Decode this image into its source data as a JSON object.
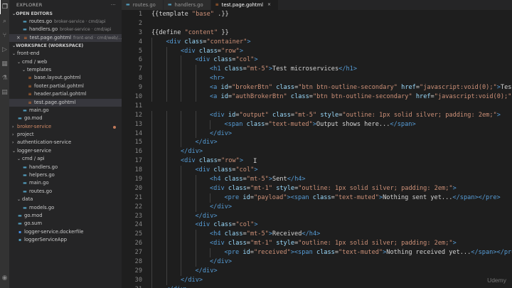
{
  "sidebar": {
    "title": "EXPLORER",
    "more": "···",
    "open_editors_label": "OPEN EDITORS",
    "open_editors": [
      {
        "name": "routes.go",
        "desc": "broker-service · cmd/api"
      },
      {
        "name": "handlers.go",
        "desc": "broker-service · cmd/api"
      },
      {
        "name": "test.page.gohtml",
        "desc": "front-end · cmd/web/...",
        "close": "×"
      }
    ],
    "workspace_label": "WORKSPACE (WORKSPACE)",
    "tree": [
      {
        "name": "front-end",
        "kind": "folder"
      },
      {
        "name": "cmd / web",
        "kind": "folder"
      },
      {
        "name": "templates",
        "kind": "folder"
      },
      {
        "name": "base.layout.gohtml",
        "kind": "file"
      },
      {
        "name": "footer.partial.gohtml",
        "kind": "file"
      },
      {
        "name": "header.partial.gohtml",
        "kind": "file"
      },
      {
        "name": "test.page.gohtml",
        "kind": "file"
      },
      {
        "name": "main.go",
        "kind": "file"
      },
      {
        "name": "go.mod",
        "kind": "file"
      },
      {
        "name": "broker-service",
        "kind": "folder"
      },
      {
        "name": "project",
        "kind": "folder"
      },
      {
        "name": "authentication-service",
        "kind": "folder"
      },
      {
        "name": "logger-service",
        "kind": "folder"
      },
      {
        "name": "cmd / api",
        "kind": "folder"
      },
      {
        "name": "handlers.go",
        "kind": "file"
      },
      {
        "name": "helpers.go",
        "kind": "file"
      },
      {
        "name": "main.go",
        "kind": "file"
      },
      {
        "name": "routes.go",
        "kind": "file"
      },
      {
        "name": "data",
        "kind": "folder"
      },
      {
        "name": "models.go",
        "kind": "file"
      },
      {
        "name": "go.mod",
        "kind": "file"
      },
      {
        "name": "go.sum",
        "kind": "file"
      },
      {
        "name": "logger-service.dockerfile",
        "kind": "file"
      },
      {
        "name": "loggerServiceApp",
        "kind": "file"
      }
    ]
  },
  "tabs": [
    {
      "label": "routes.go",
      "active": false
    },
    {
      "label": "handlers.go",
      "active": false
    },
    {
      "label": "test.page.gohtml",
      "active": true,
      "close": "×"
    }
  ],
  "code_lines": [
    "{{template \"base\" .}}",
    "",
    "{{define \"content\" }}",
    "    <div class=\"container\">",
    "        <div class=\"row\">",
    "            <div class=\"col\">",
    "                <h1 class=\"mt-5\">Test microservices</h1>",
    "                <hr>",
    "                <a id=\"brokerBtn\" class=\"btn btn-outline-secondary\" href=\"javascript:void(0);\">Tes",
    "                <a id=\"authBrokerBtn\" class=\"btn btn-outline-secondary\" href=\"javascript:void(0);\"",
    "",
    "                <div id=\"output\" class=\"mt-5\" style=\"outline: 1px solid silver; padding: 2em;\">",
    "                    <span class=\"text-muted\">Output shows here...</span>",
    "                </div>",
    "            </div>",
    "        </div>",
    "        <div class=\"row\">",
    "            <div class=\"col\">",
    "                <h4 class=\"mt-5\">Sent</h4>",
    "                <div class=\"mt-1\" style=\"outline: 1px solid silver; padding: 2em;\">",
    "                    <pre id=\"payload\"><span class=\"text-muted\">Nothing sent yet...</span></pre>",
    "                </div>",
    "            </div>",
    "            <div class=\"col\">",
    "                <h4 class=\"mt-5\">Received</h4>",
    "                <div class=\"mt-1\" style=\"outline: 1px solid silver; padding: 2em;\">",
    "                    <pre id=\"received\"><span class=\"text-muted\">Nothing received yet...</span></pre>",
    "                </div>",
    "            </div>",
    "        </div>",
    "    </div>"
  ],
  "watermark": "Udemy",
  "icons": {
    "explorer": "files-icon",
    "search": "search-icon",
    "source_control": "source-control-icon",
    "run": "run-debug-icon",
    "extensions": "extensions-icon",
    "test": "test-flask-icon",
    "docker": "docker-icon",
    "account": "account-icon"
  },
  "colors": {
    "tag": "#569cd6",
    "attr": "#9cdcfe",
    "string": "#ce9178",
    "text": "#d4d4d4",
    "line_number": "#858585"
  }
}
